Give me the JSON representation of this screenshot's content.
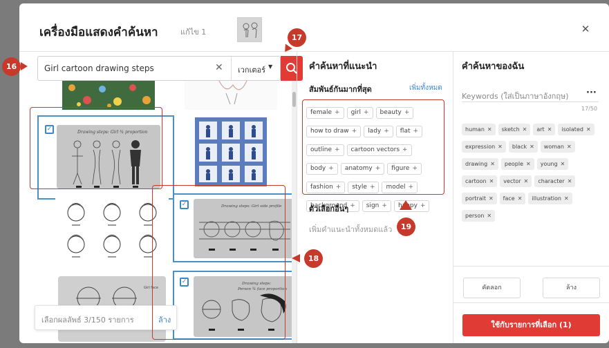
{
  "modal": {
    "title": "เครื่องมือแสดงคำค้นหา",
    "edit_label": "แก้ไข 1",
    "close_icon": "close-icon"
  },
  "search": {
    "query": "Girl cartoon drawing steps",
    "type_label": "เวกเตอร์"
  },
  "results": {
    "tiles": [
      {
        "id": "t1",
        "selected": false
      },
      {
        "id": "t2",
        "selected": false
      },
      {
        "id": "t3",
        "selected": true
      },
      {
        "id": "t4",
        "selected": false
      },
      {
        "id": "t5",
        "selected": false
      },
      {
        "id": "t6",
        "selected": true
      },
      {
        "id": "t7",
        "selected": false
      },
      {
        "id": "t8",
        "selected": true
      }
    ],
    "selection_text": "เลือกผลลัพธ์ 3/150 รายการ",
    "clear_label": "ล้าง"
  },
  "suggested": {
    "title": "คำค้นหาที่แนะนำ",
    "related_label": "สัมพันธ์กันมากที่สุด",
    "add_all_label": "เพิ่มทั้งหมด",
    "chips": [
      "female",
      "girl",
      "beauty",
      "how to draw",
      "lady",
      "flat",
      "outline",
      "cartoon vectors",
      "body",
      "anatomy",
      "figure",
      "fashion",
      "style",
      "model",
      "background",
      "sign",
      "happy"
    ],
    "other_title": "ตัวเลือกอื่นๆ",
    "other_empty": "เพิ่มคำแนะนำทั้งหมดแล้ว"
  },
  "my_search": {
    "title": "คำค้นหาของฉัน",
    "keywords_placeholder": "Keywords (ใส่เป็นภาษาอังกฤษ)",
    "count": "17/50",
    "chips": [
      "human",
      "sketch",
      "art",
      "isolated",
      "expression",
      "black",
      "woman",
      "drawing",
      "people",
      "young",
      "cartoon",
      "vector",
      "character",
      "portrait",
      "face",
      "illustration",
      "person"
    ],
    "copy_label": "คัดลอก",
    "clear_label": "ล้าง",
    "apply_label": "ใช้กับรายการที่เลือก (1)"
  },
  "annotations": [
    "16",
    "17",
    "18",
    "19"
  ],
  "colors": {
    "accent": "#e03b34",
    "selection": "#4a8fc7",
    "annotation": "#c53a2b"
  }
}
